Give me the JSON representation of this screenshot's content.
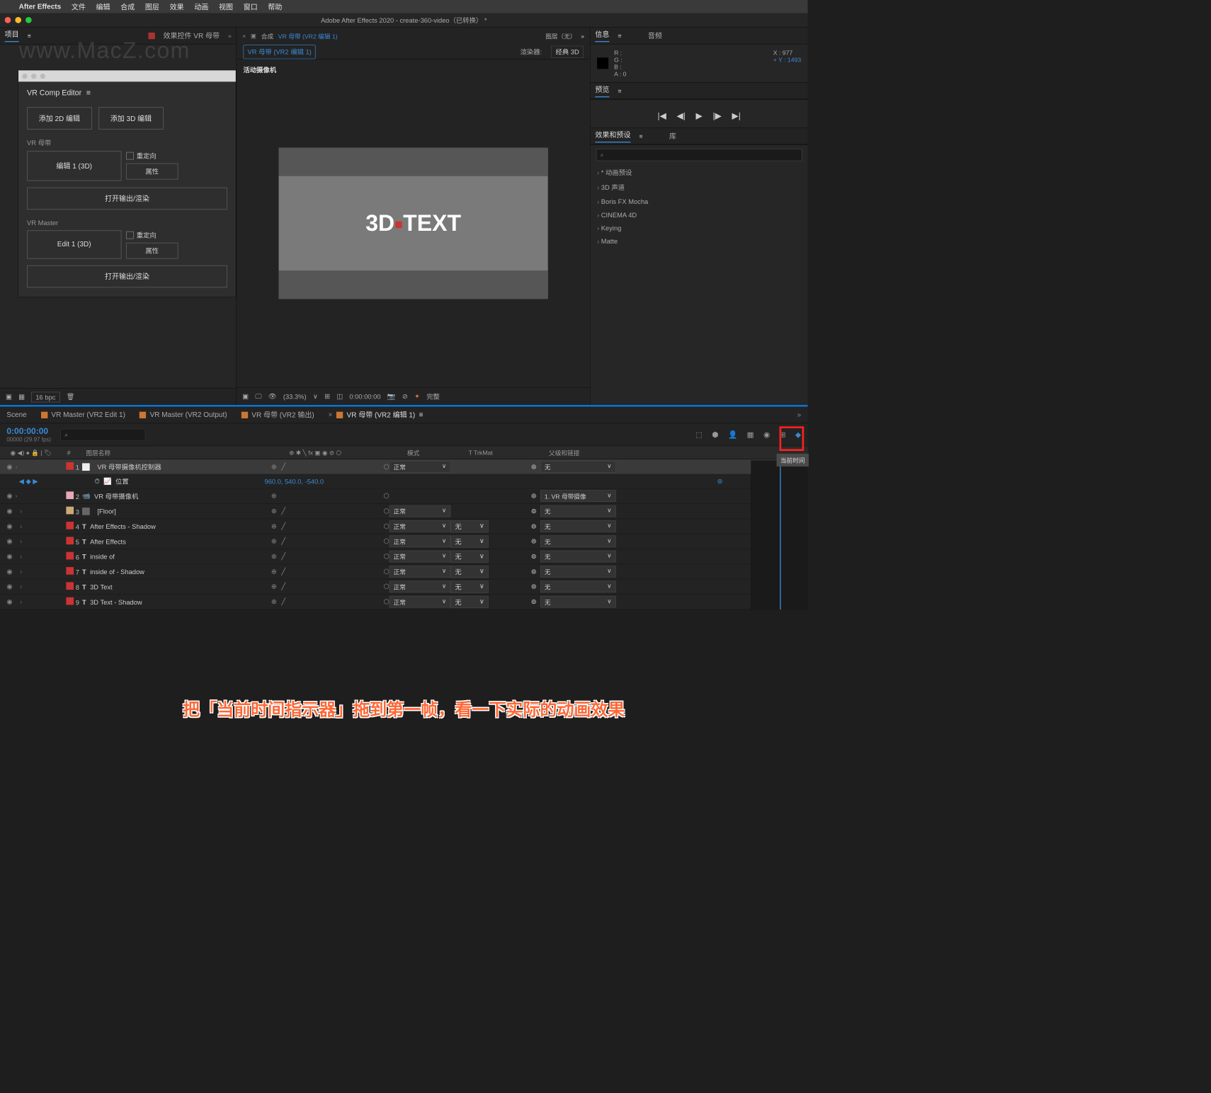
{
  "menubar": {
    "app": "After Effects",
    "items": [
      "文件",
      "编辑",
      "合成",
      "图层",
      "效果",
      "动画",
      "视图",
      "窗口",
      "帮助"
    ]
  },
  "titlebar": "Adobe After Effects 2020 - create-360-video（已转换） *",
  "left": {
    "project_tab": "项目",
    "effect_controls_tab": "效果控件 VR 母带",
    "menu_glyph": "≡"
  },
  "vr_editor": {
    "title": "VR Comp Editor",
    "menu_glyph": "≡",
    "add_2d": "添加 2D 编辑",
    "add_3d": "添加 3D 编辑",
    "section1": "VR 母带",
    "edit1_btn": "编辑 1 (3D)",
    "reorient": "重定向",
    "props": "属性",
    "open_render": "打开输出/渲染",
    "section2": "VR Master",
    "edit2_btn": "Edit 1 (3D)"
  },
  "comp": {
    "tab_label": "合成",
    "tab_name": "VR 母带 (VR2 编辑 1)",
    "layer_none": "图层（无）",
    "subtab": "VR 母带 (VR2 编辑 1)",
    "renderer_label": "渲染器:",
    "renderer_value": "经典 3D",
    "active_camera": "活动摄像机",
    "canvas_text_a": "3D",
    "canvas_text_b": "TEXT",
    "toolbar": {
      "zoom": "(33.3%)",
      "time": "0:00:00:00",
      "quality": "完整"
    }
  },
  "info": {
    "tab_info": "信息",
    "tab_audio": "音频",
    "menu_glyph": "≡",
    "r": "R :",
    "g": "G :",
    "b": "B :",
    "a": "A : 0",
    "x": "X : 977",
    "y": "Y : 1493"
  },
  "preview": {
    "tab": "预览",
    "menu_glyph": "≡"
  },
  "effects_presets": {
    "tab_fx": "效果和预设",
    "tab_lib": "库",
    "menu_glyph": "≡",
    "search_placeholder": "⌕",
    "items": [
      "* 动画预设",
      "3D 声道",
      "Boris FX Mocha",
      "CINEMA 4D",
      "Keying",
      "Matte"
    ]
  },
  "proj_toolbar": {
    "bpc": "16 bpc"
  },
  "timeline": {
    "tabs": [
      {
        "label": "Scene",
        "color": "#cc7733"
      },
      {
        "label": "VR Master (VR2 Edit 1)",
        "color": "#cc7733"
      },
      {
        "label": "VR Master (VR2 Output)",
        "color": "#cc7733"
      },
      {
        "label": "VR 母带 (VR2 输出)",
        "color": "#cc7733"
      },
      {
        "label": "VR 母带 (VR2 编辑 1)",
        "color": "#cc7733",
        "active": true
      }
    ],
    "timecode": "0:00:00:00",
    "fps": "00000 (29.97 fps)",
    "search_placeholder": "⌕",
    "columns": {
      "num": "#",
      "name": "图层名称",
      "switches": "⊕ ✱ ╲ fx ▣ ◉ ⊘ ⬡",
      "mode": "模式",
      "trackmatte": "T  TrkMat",
      "parent": "父级和链接"
    },
    "layers": [
      {
        "num": 1,
        "color": "#cc3333",
        "icon_color": "#eee",
        "name": "VR 母带摄像机控制器",
        "type": "solid",
        "mode": "正常",
        "parent": "无",
        "selected": true
      },
      {
        "num": 2,
        "color": "#e8a8b8",
        "name": "VR 母带摄像机",
        "type": "camera",
        "parent": "1. VR 母带摄像"
      },
      {
        "num": 3,
        "color": "#ccaa77",
        "icon_color": "#666",
        "name": "[Floor]",
        "type": "solid",
        "mode": "正常",
        "parent": "无"
      },
      {
        "num": 4,
        "color": "#cc3333",
        "name": "After Effects - Shadow",
        "type": "text",
        "mode": "正常",
        "trkmat": "无",
        "parent": "无"
      },
      {
        "num": 5,
        "color": "#cc3333",
        "name": "After Effects",
        "type": "text",
        "mode": "正常",
        "trkmat": "无",
        "parent": "无"
      },
      {
        "num": 6,
        "color": "#cc3333",
        "name": "inside of",
        "type": "text",
        "mode": "正常",
        "trkmat": "无",
        "parent": "无"
      },
      {
        "num": 7,
        "color": "#cc3333",
        "name": "inside of - Shadow",
        "type": "text",
        "mode": "正常",
        "trkmat": "无",
        "parent": "无"
      },
      {
        "num": 8,
        "color": "#cc3333",
        "name": "3D Text",
        "type": "text",
        "mode": "正常",
        "trkmat": "无",
        "parent": "无"
      },
      {
        "num": 9,
        "color": "#cc3333",
        "name": "3D Text - Shadow",
        "type": "text",
        "mode": "正常",
        "trkmat": "无",
        "parent": "无"
      }
    ],
    "position_prop": {
      "name": "位置",
      "value": "960.0, 540.0, -540.0"
    },
    "tooltip": "当前时间"
  },
  "annotation": "把「当前时间指示器」拖到第一帧，看一下实际的动画效果",
  "watermark": "www.MacZ.com"
}
